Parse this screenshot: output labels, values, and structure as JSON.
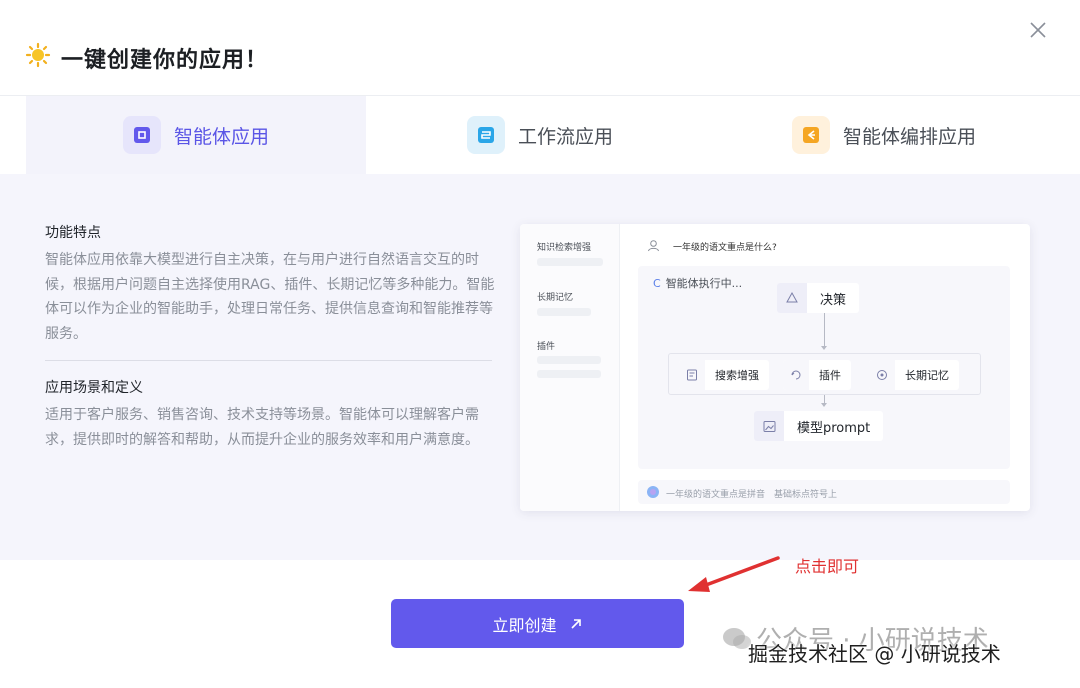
{
  "header": {
    "title": "一键创建你的应用！",
    "icon": "sun-icon"
  },
  "tabs": [
    {
      "label": "智能体应用",
      "icon": "agent-app-icon",
      "color": "#5a55e6",
      "active": true
    },
    {
      "label": "工作流应用",
      "icon": "workflow-app-icon",
      "color": "#2aa6e8",
      "active": false
    },
    {
      "label": "智能体编排应用",
      "icon": "agent-orchestration-icon",
      "color": "#f5a623",
      "active": false
    }
  ],
  "features": {
    "title": "功能特点",
    "text": "智能体应用依靠大模型进行自主决策，在与用户进行自然语言交互的时候，根据用户问题自主选择使用RAG、插件、长期记忆等多种能力。智能体可以作为企业的智能助手，处理日常任务、提供信息查询和智能推荐等服务。"
  },
  "scenarios": {
    "title": "应用场景和定义",
    "text": "适用于客户服务、销售咨询、技术支持等场景。智能体可以理解客户需求，提供即时的解答和帮助，从而提升企业的服务效率和用户满意度。"
  },
  "preview": {
    "side_items": [
      "知识检索增强",
      "长期记忆",
      "插件"
    ],
    "question": "一年级的语文重点是什么?",
    "executing": "智能体执行中...",
    "decision": "决策",
    "tools": [
      "搜索增强",
      "插件",
      "长期记忆"
    ],
    "model": "模型prompt",
    "input_text": "一年级的语文重点是拼音　基础标点符号上"
  },
  "annotation": "点击即可",
  "create_button": "立即创建",
  "watermark": {
    "official": "公众号 · 小研说技术",
    "site": "掘金技术社区 @ 小研说技术"
  },
  "colors": {
    "accent": "#6259ec",
    "panel_bg": "#f5f5fc",
    "annotation": "#e03131"
  }
}
